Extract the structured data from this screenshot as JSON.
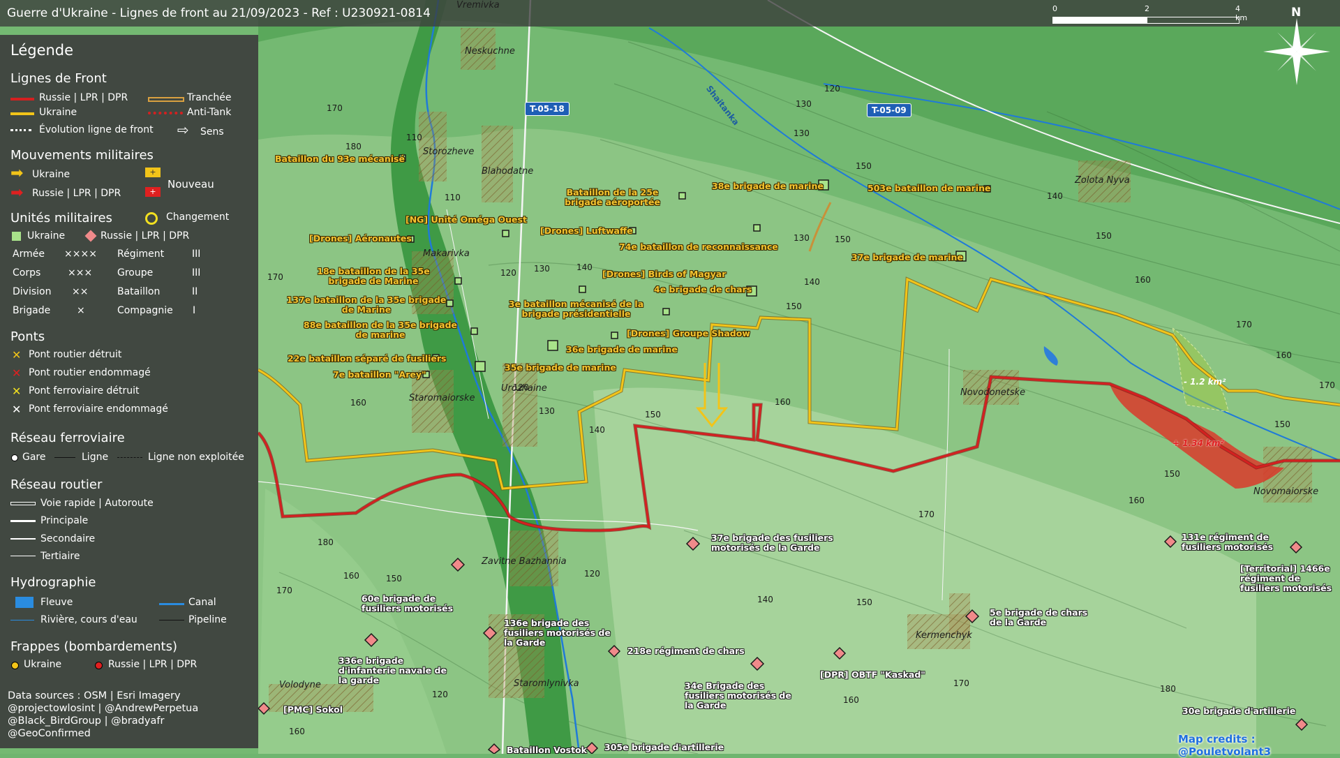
{
  "title": "Guerre d'Ukraine - Lignes de front au 21/09/2023 - Ref : U230921-0814",
  "scale": {
    "ticks": [
      "0",
      "2",
      "4 km"
    ]
  },
  "north_label": "N",
  "legend": {
    "title": "Légende",
    "front_lines": {
      "heading": "Lignes de Front",
      "russia": "Russie | LPR | DPR",
      "ukraine": "Ukraine",
      "evolution": "Évolution ligne de front",
      "trench": "Tranchée",
      "antitank": "Anti-Tank",
      "direction": "Sens"
    },
    "movements": {
      "heading": "Mouvements militaires",
      "ukraine": "Ukraine",
      "russia": "Russie | LPR | DPR",
      "new": "Nouveau"
    },
    "units": {
      "heading": "Unités militaires",
      "change": "Changement",
      "ukraine": "Ukraine",
      "russia": "Russie | LPR | DPR",
      "rows": [
        {
          "a": "Armée",
          "as": "××××",
          "b": "Régiment",
          "bs": "III"
        },
        {
          "a": "Corps",
          "as": "×××",
          "b": "Groupe",
          "bs": "III"
        },
        {
          "a": "Division",
          "as": "××",
          "b": "Bataillon",
          "bs": "II"
        },
        {
          "a": "Brigade",
          "as": "×",
          "b": "Compagnie",
          "bs": "I"
        }
      ]
    },
    "bridges": {
      "heading": "Ponts",
      "items": [
        "Pont routier détruit",
        "Pont routier endommagé",
        "Pont ferroviaire détruit",
        "Pont ferroviaire endommagé"
      ]
    },
    "rail": {
      "heading": "Réseau ferroviaire",
      "station": "Gare",
      "line": "Ligne",
      "unused": "Ligne non exploitée"
    },
    "roads": {
      "heading": "Réseau routier",
      "items": [
        "Voie rapide | Autoroute",
        "Principale",
        "Secondaire",
        "Tertiaire"
      ]
    },
    "hydro": {
      "heading": "Hydrographie",
      "river_major": "Fleuve",
      "canal": "Canal",
      "river": "Rivière, cours d'eau",
      "pipeline": "Pipeline"
    },
    "strikes": {
      "heading": "Frappes (bombardements)",
      "ukraine": "Ukraine",
      "russia": "Russie | LPR | DPR"
    },
    "credits": [
      "Data sources : OSM | Esri Imagery",
      "@projectowlosint | @AndrewPerpetua",
      "@Black_BirdGroup | @bradyafr",
      "@GeoConfirmed"
    ]
  },
  "map_credit": "Map credits : @Pouletvolant3",
  "roads": [
    "T-05-18",
    "T-05-09"
  ],
  "river_name": "Shaitanka",
  "places": [
    "Vremivka",
    "Neskuchne",
    "Storozheve",
    "Blahodatne",
    "Makarivka",
    "Staromaiorske",
    "Urozhaine",
    "Zavitne Bazhannia",
    "Staromlynivka",
    "Volodyne",
    "Novodonetske",
    "Zolota Nyva",
    "Novomaiorske",
    "Kermenchyk"
  ],
  "ukraine_units": [
    "Bataillon du 93e mécanisé",
    "Bataillon de la 25e brigade aéroportée",
    "38e brigade de marine",
    "503e bataillon de marine",
    "[NG] Unité Oméga Ouest",
    "[Drones] Luftwaffe",
    "[Drones] Aéronautes",
    "74e bataillon de reconnaissance",
    "37e brigade de marine",
    "18e bataillon de la 35e brigade de Marine",
    "[Drones] Birds of Magyar",
    "4e brigade de chars",
    "137e bataillon de la 35e brigade de Marine",
    "3e bataillon mécanisé de la brigade présidentielle",
    "88e bataillon de la 35e brigade de marine",
    "[Drones] Groupe Shadow",
    "36e brigade de marine",
    "22e bataillon séparé de fusiliers",
    "35e brigade de marine",
    "7e bataillon \"Arey\""
  ],
  "russia_units": [
    "37e brigade des fusiliers motorisés de la Garde",
    "131e régiment de fusiliers motorisés",
    "[Territorial] 1466e régiment de fusiliers motorisés",
    "60e brigade de fusiliers motorisés",
    "136e brigade des fusiliers motorisés de la Garde",
    "5e brigade de chars de la Garde",
    "336e brigade d'infanterie navale de la garde",
    "218e régiment de chars",
    "[DPR] OBTF \"Kaskad\"",
    "34e Brigade des fusiliers motorisés de la Garde",
    "[PMC] Sokol",
    "30e brigade d'artillerie",
    "Bataillon Vostok",
    "305e brigade d'artillerie"
  ],
  "area_labels": [
    "- 1.2 km²",
    "+ 1.34 km²"
  ],
  "elevations": [
    "170",
    "180",
    "110",
    "110",
    "120",
    "130",
    "140",
    "120",
    "130",
    "140",
    "150",
    "150",
    "130",
    "140",
    "150",
    "160",
    "170",
    "170",
    "140",
    "160",
    "150",
    "130",
    "120",
    "130",
    "140",
    "150",
    "160",
    "170",
    "180",
    "160",
    "150",
    "170",
    "160",
    "170",
    "150",
    "160",
    "170",
    "150",
    "180",
    "160",
    "170",
    "120",
    "160",
    "150",
    "120",
    "140"
  ],
  "colors": {
    "russia_line": "#d42020",
    "ukraine_line": "#f2c419",
    "ukraine_unit": "#a8e28a",
    "russia_unit": "#f08a8a",
    "russia_gain": "#d93a2a"
  }
}
